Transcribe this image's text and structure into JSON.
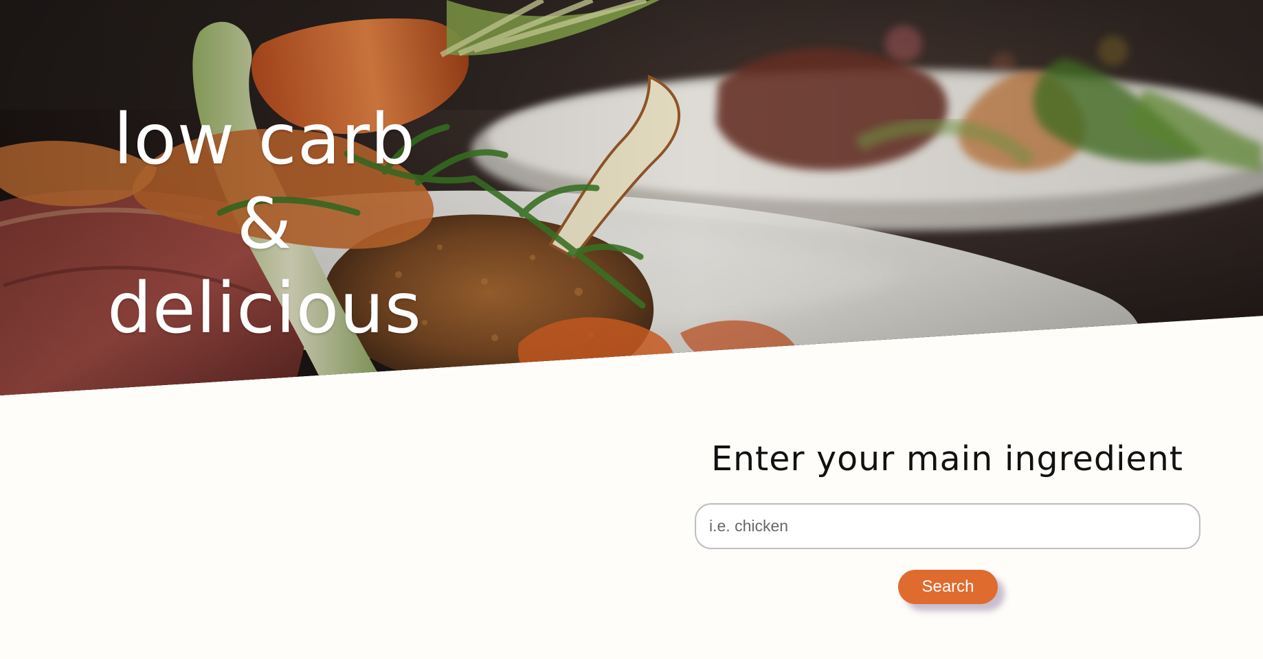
{
  "hero": {
    "title_lines": [
      "low carb",
      "&",
      "delicious"
    ],
    "image_description": "plated meat dish with carrots, herbs and vegetables"
  },
  "search": {
    "title": "Enter your main ingredient",
    "placeholder": "i.e. chicken",
    "button_label": "Search"
  },
  "colors": {
    "page_background": "#fefdf9",
    "accent": "#e06b2f",
    "hero_text": "#ffffff",
    "heading_text": "#111111"
  }
}
